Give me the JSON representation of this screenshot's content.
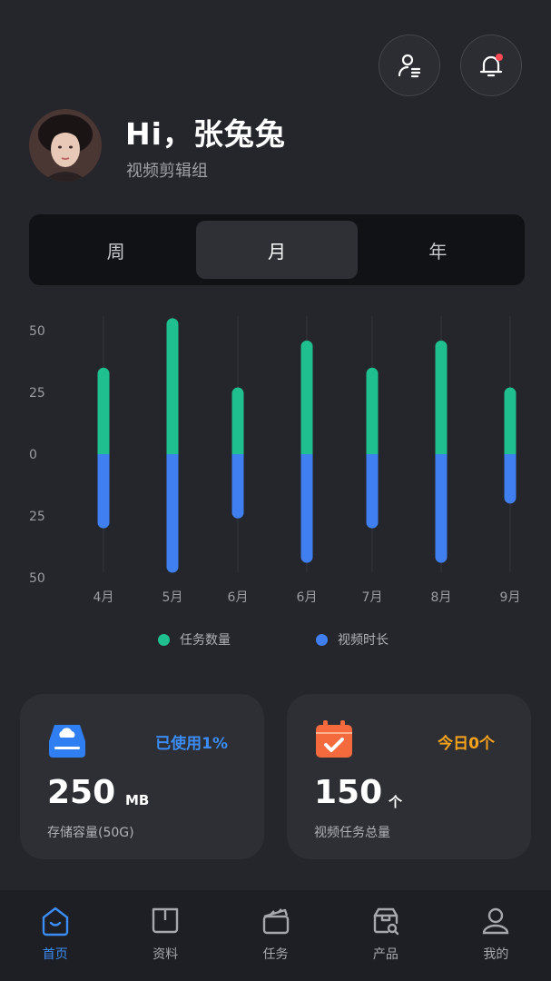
{
  "header": {
    "greeting": "Hi，张兔兔",
    "subtitle": "视频剪辑组"
  },
  "segments": [
    {
      "label": "周",
      "active": false
    },
    {
      "label": "月",
      "active": true
    },
    {
      "label": "年",
      "active": false
    }
  ],
  "chart_data": {
    "type": "bar",
    "categories": [
      "4月",
      "5月",
      "6月",
      "6月",
      "7月",
      "8月",
      "9月"
    ],
    "y_tick_labels": [
      "50",
      "25",
      "0",
      "25",
      "50"
    ],
    "ylim": [
      -50,
      50
    ],
    "series": [
      {
        "name": "任务数量",
        "values": [
          35,
          55,
          27,
          46,
          35,
          46,
          27
        ],
        "color": "#1fbf8f"
      },
      {
        "name": "视频时长",
        "values": [
          -30,
          -48,
          -26,
          -44,
          -30,
          -44,
          -20
        ],
        "color": "#3f7ff0"
      }
    ],
    "legend_position": "bottom",
    "grid": true
  },
  "cards": {
    "storage": {
      "tag": "已使用1%",
      "value": "250",
      "unit": "MB",
      "label": "存储容量(50G)",
      "tag_color": "#3b8cf5"
    },
    "task": {
      "tag": "今日0个",
      "value": "150",
      "unit": "个",
      "label": "视频任务总量",
      "tag_color": "#f7a21b"
    }
  },
  "tabbar": [
    {
      "label": "首页",
      "icon": "home-icon",
      "active": true
    },
    {
      "label": "资料",
      "icon": "book-icon",
      "active": false
    },
    {
      "label": "任务",
      "icon": "clapperboard-icon",
      "active": false
    },
    {
      "label": "产品",
      "icon": "box-search-icon",
      "active": false
    },
    {
      "label": "我的",
      "icon": "user-icon",
      "active": false
    }
  ]
}
